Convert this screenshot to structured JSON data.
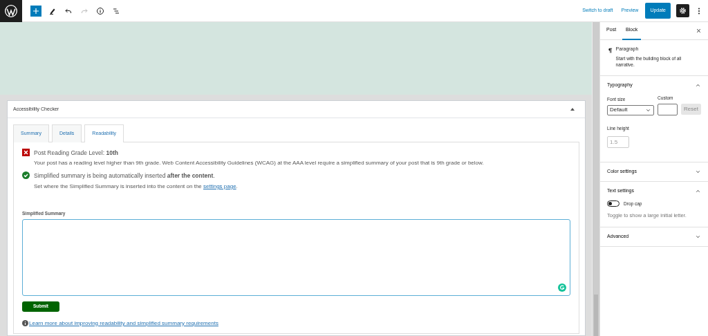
{
  "toolbar": {
    "actions": [
      {
        "label": "Switch to draft",
        "kind": "link"
      },
      {
        "label": "Preview",
        "kind": "link"
      },
      {
        "label": "Update",
        "kind": "primary"
      }
    ],
    "redo_disabled": true,
    "settings_selected": true
  },
  "metabox": {
    "title": "Accessibility Checker",
    "expanded": true,
    "tabs": [
      {
        "label": "Summary",
        "selected": false
      },
      {
        "label": "Details",
        "selected": false
      },
      {
        "label": "Readability",
        "selected": true
      }
    ],
    "checks": [
      {
        "kind": "fail",
        "title": "Post Reading Grade Level: **10th**",
        "description": "Your post has a reading level higher than 9th grade. Web Content Accessibility Guidelines (WCAG) at the AAA level require a simplified summary of your post that is 9th grade or below."
      },
      {
        "kind": "pass",
        "title": "Simplified summary is being automatically inserted **after the content**.",
        "description": "Set where the Simplified Summary is inserted into the content on the ",
        "link": "settings page",
        "after_link": "."
      }
    ],
    "summary_label": "Simplified Summary",
    "submit": "Submit",
    "learn_more": "Learn more about improving readability and simplified summary requirements"
  },
  "sidebar": {
    "tabs": [
      {
        "label": "Post",
        "selected": false
      },
      {
        "label": "Block",
        "selected": true
      }
    ],
    "block": {
      "name": "Paragraph",
      "description": "Start with the building block of all narrative."
    },
    "panels": [
      {
        "title": "Typography",
        "expanded": true,
        "kind": "typography",
        "font_size_label": "Font size",
        "font_size": "Default",
        "custom_label": "Custom",
        "reset": "Reset",
        "line_height_label": "Line height",
        "line_height_placeholder": "1.5"
      },
      {
        "title": "Color settings",
        "expanded": false
      },
      {
        "title": "Text settings",
        "expanded": true,
        "kind": "text",
        "toggle_label": "Drop cap",
        "on": false,
        "help": "Toggle to show a large initial letter."
      },
      {
        "title": "Advanced",
        "expanded": false
      }
    ]
  }
}
